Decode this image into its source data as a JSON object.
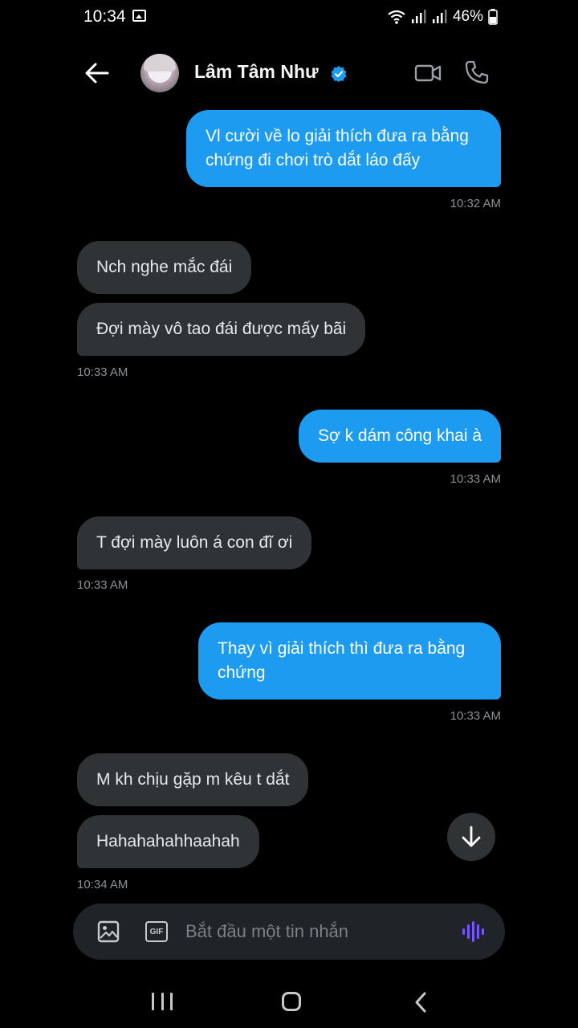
{
  "status": {
    "time": "10:34",
    "battery": "46%"
  },
  "header": {
    "contact_name": "Lâm Tâm Như"
  },
  "messages": [
    {
      "direction": "out",
      "text": "Vl cười về lo giải thích đưa ra bằng chứng đi chơi trò dắt láo đấy"
    },
    {
      "direction": "out_time",
      "text": "10:32 AM"
    },
    {
      "direction": "in",
      "text": "Nch nghe mắc đái"
    },
    {
      "direction": "in",
      "text": "Đợi mày vô tao đái được mấy bãi"
    },
    {
      "direction": "in_time",
      "text": "10:33 AM"
    },
    {
      "direction": "out",
      "text": "Sợ k dám công khai à"
    },
    {
      "direction": "out_time",
      "text": "10:33 AM"
    },
    {
      "direction": "in",
      "text": "T đợi mày luôn á con đĩ ơi"
    },
    {
      "direction": "in_time",
      "text": "10:33 AM"
    },
    {
      "direction": "out",
      "text": "Thay vì giải thích thì đưa ra bằng chứng"
    },
    {
      "direction": "out_time",
      "text": "10:33 AM"
    },
    {
      "direction": "in",
      "text": "M kh chịu gặp m kêu t dắt"
    },
    {
      "direction": "in",
      "text": "Hahahahahhaahah"
    },
    {
      "direction": "in_time",
      "text": "10:34 AM"
    }
  ],
  "composer": {
    "placeholder": "Bắt đầu một tin nhắn",
    "gif_label": "GIF"
  },
  "colors": {
    "outgoing_bubble": "#1d9bf0",
    "incoming_bubble": "#2f3336",
    "background": "#000000",
    "verified": "#1d9bf0",
    "voice_accent": "#7856ff"
  }
}
